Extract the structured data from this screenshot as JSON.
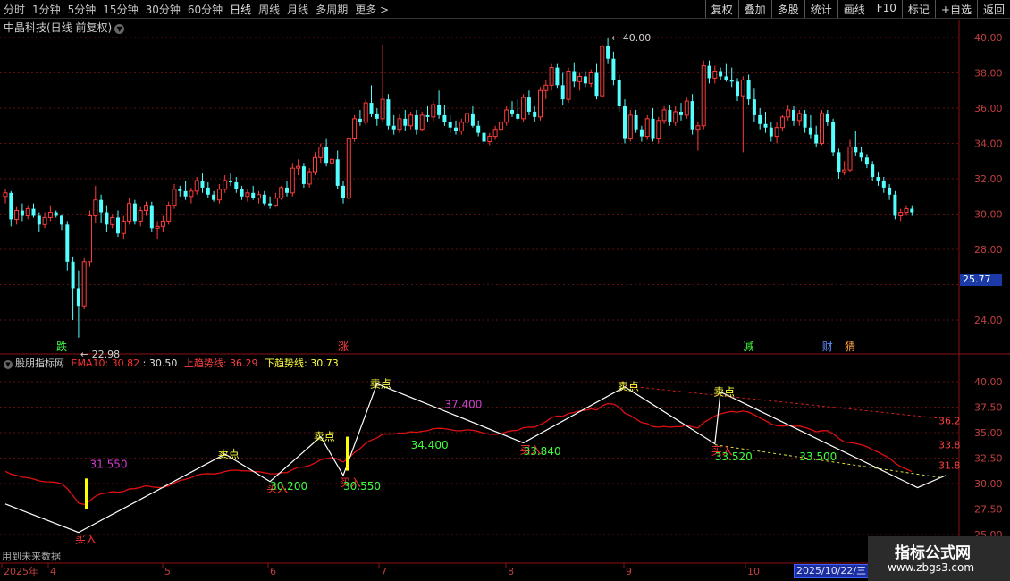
{
  "toolbar": {
    "periods": [
      "分时",
      "1分钟",
      "5分钟",
      "15分钟",
      "30分钟",
      "60分钟",
      "日线",
      "周线",
      "月线",
      "多周期",
      "更多 >"
    ],
    "actions": [
      "复权",
      "叠加",
      "多股",
      "统计",
      "画线",
      "F10",
      "标记",
      "+自选",
      "返回"
    ]
  },
  "stock_title": "中晶科技(日线 前复权)",
  "price_axis": [
    "40.00",
    "38.00",
    "36.00",
    "34.00",
    "32.00",
    "30.00",
    "28.00",
    "24.00"
  ],
  "current_price": "25.77",
  "annotations": {
    "high": "40.00",
    "low": "22.98"
  },
  "markers": [
    "跌",
    "涨",
    "减",
    "财",
    "猜"
  ],
  "indicator": {
    "name": "股朋指标网",
    "ema_label": "EMA10: 30.82",
    "ema_value": ": 30.50",
    "up_trend": "上趋势线: 36.29",
    "down_trend": "下趋势线: 30.73"
  },
  "indicator_axis": [
    "40.00",
    "37.50",
    "35.00",
    "32.50",
    "30.00",
    "27.50",
    "25.00"
  ],
  "indicator_labels": {
    "buy": "买入",
    "sell": "卖点",
    "values": [
      "31.550",
      "30.200",
      "30.550",
      "34.400",
      "37.400",
      "33.840",
      "33.520",
      "33.500"
    ],
    "right_values": [
      "36.2",
      "33.8",
      "31.8"
    ]
  },
  "time_axis": [
    "2025年",
    "4",
    "5",
    "6",
    "7",
    "8",
    "9",
    "10"
  ],
  "date_box": "2025/10/22/三",
  "future_note": "用到未来数据",
  "watermark": {
    "name": "指标公式网",
    "url": "www.zbgs3.com"
  },
  "colors": {
    "up": "#ff3c3c",
    "down": "#54ffff",
    "ema": "#e01010",
    "grid": "#5a1010"
  },
  "chart_data": {
    "type": "candlestick",
    "ylim": [
      22.5,
      41
    ],
    "candles": [
      [
        31.0,
        31.4,
        30.6,
        31.2
      ],
      [
        31.2,
        31.3,
        29.3,
        29.7
      ],
      [
        29.7,
        30.4,
        29.4,
        30.2
      ],
      [
        30.2,
        30.6,
        29.6,
        29.9
      ],
      [
        29.9,
        30.5,
        29.7,
        30.3
      ],
      [
        30.3,
        30.6,
        29.8,
        29.9
      ],
      [
        29.9,
        30.1,
        29.0,
        29.4
      ],
      [
        29.4,
        30.1,
        29.2,
        29.8
      ],
      [
        29.8,
        30.5,
        29.6,
        30.1
      ],
      [
        30.1,
        30.2,
        29.8,
        29.9
      ],
      [
        29.9,
        30.0,
        29.1,
        29.4
      ],
      [
        29.4,
        29.6,
        26.8,
        27.3
      ],
      [
        27.3,
        27.6,
        24.0,
        25.8
      ],
      [
        25.8,
        26.8,
        23.0,
        24.8
      ],
      [
        24.8,
        27.5,
        24.6,
        27.3
      ],
      [
        27.3,
        30.2,
        27.0,
        29.9
      ],
      [
        29.9,
        31.6,
        29.5,
        30.8
      ],
      [
        30.8,
        31.1,
        29.5,
        30.1
      ],
      [
        30.1,
        30.5,
        29.0,
        29.4
      ],
      [
        29.4,
        30.0,
        29.2,
        29.8
      ],
      [
        29.8,
        30.2,
        28.7,
        28.9
      ],
      [
        28.9,
        29.9,
        28.6,
        29.6
      ],
      [
        29.6,
        30.9,
        29.4,
        30.6
      ],
      [
        30.6,
        30.8,
        29.4,
        29.6
      ],
      [
        29.6,
        30.4,
        29.3,
        30.2
      ],
      [
        30.2,
        30.7,
        29.9,
        30.5
      ],
      [
        30.5,
        30.7,
        29.0,
        29.2
      ],
      [
        29.2,
        29.6,
        28.6,
        29.3
      ],
      [
        29.3,
        29.9,
        29.0,
        29.6
      ],
      [
        29.6,
        30.7,
        29.4,
        30.5
      ],
      [
        30.5,
        31.7,
        30.3,
        31.4
      ],
      [
        31.4,
        31.6,
        31.0,
        31.3
      ],
      [
        31.3,
        31.9,
        30.8,
        31.0
      ],
      [
        31.0,
        31.5,
        30.6,
        31.3
      ],
      [
        31.3,
        32.1,
        31.1,
        31.9
      ],
      [
        31.9,
        32.3,
        31.2,
        31.5
      ],
      [
        31.5,
        31.8,
        30.9,
        31.1
      ],
      [
        31.1,
        31.3,
        30.7,
        30.8
      ],
      [
        30.8,
        31.7,
        30.6,
        31.4
      ],
      [
        31.4,
        32.2,
        31.2,
        31.9
      ],
      [
        31.9,
        32.3,
        31.6,
        31.8
      ],
      [
        31.8,
        32.1,
        31.2,
        31.4
      ],
      [
        31.4,
        31.6,
        30.8,
        31.0
      ],
      [
        31.0,
        31.4,
        30.7,
        31.2
      ],
      [
        31.2,
        31.6,
        30.8,
        30.9
      ],
      [
        30.9,
        31.3,
        30.6,
        31.1
      ],
      [
        31.1,
        31.3,
        30.5,
        30.6
      ],
      [
        30.6,
        31.0,
        30.3,
        30.5
      ],
      [
        30.5,
        31.2,
        30.4,
        30.9
      ],
      [
        30.9,
        31.6,
        30.8,
        31.5
      ],
      [
        31.5,
        31.9,
        31.0,
        31.2
      ],
      [
        31.2,
        32.9,
        31.0,
        32.6
      ],
      [
        32.6,
        33.1,
        32.2,
        32.7
      ],
      [
        32.7,
        32.9,
        31.5,
        31.7
      ],
      [
        31.7,
        32.6,
        31.5,
        32.4
      ],
      [
        32.4,
        33.5,
        32.2,
        33.2
      ],
      [
        33.2,
        34.0,
        32.9,
        33.8
      ],
      [
        33.8,
        34.3,
        32.7,
        32.9
      ],
      [
        32.9,
        33.4,
        32.2,
        33.1
      ],
      [
        33.1,
        33.6,
        31.4,
        31.6
      ],
      [
        31.6,
        31.9,
        30.6,
        30.9
      ],
      [
        30.9,
        34.4,
        30.8,
        34.3
      ],
      [
        34.3,
        35.6,
        34.1,
        35.4
      ],
      [
        35.4,
        35.9,
        35.0,
        35.2
      ],
      [
        35.2,
        36.5,
        35.0,
        36.3
      ],
      [
        36.3,
        37.3,
        35.5,
        35.7
      ],
      [
        35.7,
        36.0,
        35.0,
        35.4
      ],
      [
        35.4,
        39.6,
        35.2,
        36.5
      ],
      [
        36.5,
        36.8,
        34.8,
        35.0
      ],
      [
        35.0,
        35.6,
        34.5,
        34.8
      ],
      [
        34.8,
        35.7,
        34.6,
        35.4
      ],
      [
        35.4,
        35.9,
        34.7,
        35.0
      ],
      [
        35.0,
        35.8,
        34.8,
        35.6
      ],
      [
        35.6,
        35.9,
        34.5,
        34.8
      ],
      [
        34.8,
        35.8,
        34.7,
        35.6
      ],
      [
        35.6,
        36.1,
        35.2,
        35.5
      ],
      [
        35.5,
        36.4,
        35.2,
        36.2
      ],
      [
        36.2,
        37.0,
        35.4,
        35.6
      ],
      [
        35.6,
        36.2,
        35.0,
        35.2
      ],
      [
        35.2,
        35.6,
        34.6,
        34.9
      ],
      [
        34.9,
        35.3,
        34.5,
        34.7
      ],
      [
        34.7,
        35.4,
        34.5,
        35.2
      ],
      [
        35.2,
        35.9,
        35.0,
        35.7
      ],
      [
        35.7,
        36.1,
        34.9,
        35.0
      ],
      [
        35.0,
        35.3,
        34.4,
        34.6
      ],
      [
        34.6,
        34.9,
        33.9,
        34.1
      ],
      [
        34.1,
        34.6,
        33.9,
        34.4
      ],
      [
        34.4,
        35.0,
        34.2,
        34.8
      ],
      [
        34.8,
        35.4,
        34.6,
        35.2
      ],
      [
        35.2,
        36.1,
        35.0,
        35.9
      ],
      [
        35.9,
        36.4,
        35.5,
        35.7
      ],
      [
        35.7,
        36.5,
        35.3,
        35.4
      ],
      [
        35.4,
        36.8,
        35.2,
        36.6
      ],
      [
        36.6,
        37.0,
        35.6,
        35.8
      ],
      [
        35.8,
        36.1,
        35.2,
        35.5
      ],
      [
        35.5,
        37.2,
        35.3,
        37.0
      ],
      [
        37.0,
        37.6,
        36.5,
        37.3
      ],
      [
        37.3,
        38.5,
        37.0,
        38.3
      ],
      [
        38.3,
        38.5,
        37.1,
        37.3
      ],
      [
        37.3,
        38.0,
        36.2,
        36.5
      ],
      [
        36.5,
        38.3,
        36.3,
        38.1
      ],
      [
        38.1,
        38.6,
        37.2,
        37.5
      ],
      [
        37.5,
        38.0,
        37.0,
        37.8
      ],
      [
        37.8,
        38.1,
        37.2,
        37.4
      ],
      [
        37.4,
        38.2,
        37.2,
        38.0
      ],
      [
        38.0,
        38.5,
        36.5,
        36.7
      ],
      [
        36.7,
        39.6,
        36.6,
        39.5
      ],
      [
        39.5,
        40.0,
        38.5,
        38.8
      ],
      [
        38.8,
        39.2,
        37.3,
        37.6
      ],
      [
        37.6,
        37.9,
        35.8,
        36.1
      ],
      [
        36.1,
        36.5,
        34.0,
        34.3
      ],
      [
        34.3,
        35.9,
        34.1,
        35.6
      ],
      [
        35.6,
        35.9,
        34.6,
        34.8
      ],
      [
        34.8,
        35.0,
        34.1,
        34.4
      ],
      [
        34.4,
        35.6,
        34.2,
        35.4
      ],
      [
        35.4,
        36.0,
        34.1,
        34.3
      ],
      [
        34.3,
        35.5,
        34.0,
        35.3
      ],
      [
        35.3,
        36.1,
        35.1,
        35.9
      ],
      [
        35.9,
        36.2,
        35.0,
        35.2
      ],
      [
        35.2,
        36.1,
        35.0,
        35.8
      ],
      [
        35.8,
        36.3,
        35.3,
        35.6
      ],
      [
        35.6,
        36.6,
        35.4,
        36.4
      ],
      [
        36.4,
        36.8,
        34.5,
        34.8
      ],
      [
        34.8,
        35.2,
        33.6,
        35.0
      ],
      [
        35.0,
        38.7,
        34.8,
        38.4
      ],
      [
        38.4,
        38.7,
        37.4,
        37.7
      ],
      [
        37.7,
        38.4,
        37.4,
        38.1
      ],
      [
        38.1,
        38.3,
        37.6,
        37.8
      ],
      [
        37.8,
        38.5,
        37.5,
        37.6
      ],
      [
        37.6,
        38.3,
        37.2,
        37.5
      ],
      [
        37.5,
        37.7,
        36.4,
        36.7
      ],
      [
        36.7,
        37.8,
        33.5,
        37.6
      ],
      [
        37.6,
        37.9,
        36.2,
        36.5
      ],
      [
        36.5,
        37.1,
        35.2,
        35.6
      ],
      [
        35.6,
        36.0,
        34.8,
        35.1
      ],
      [
        35.1,
        35.8,
        34.6,
        34.9
      ],
      [
        34.9,
        35.2,
        34.1,
        34.4
      ],
      [
        34.4,
        35.2,
        34.0,
        34.9
      ],
      [
        34.9,
        35.6,
        34.7,
        35.5
      ],
      [
        35.5,
        36.2,
        35.3,
        35.9
      ],
      [
        35.9,
        36.1,
        35.0,
        35.3
      ],
      [
        35.3,
        35.9,
        35.0,
        35.7
      ],
      [
        35.7,
        35.9,
        34.6,
        34.9
      ],
      [
        34.9,
        35.6,
        34.3,
        34.5
      ],
      [
        34.5,
        35.0,
        33.8,
        34.0
      ],
      [
        34.0,
        35.9,
        33.9,
        35.7
      ],
      [
        35.7,
        35.9,
        35.0,
        35.2
      ],
      [
        35.2,
        35.4,
        33.3,
        33.5
      ],
      [
        33.5,
        33.7,
        32.0,
        32.4
      ],
      [
        32.4,
        33.0,
        32.2,
        32.5
      ],
      [
        32.5,
        34.2,
        32.4,
        33.8
      ],
      [
        33.8,
        34.7,
        33.3,
        33.5
      ],
      [
        33.5,
        33.8,
        33.0,
        33.2
      ],
      [
        33.2,
        33.4,
        32.6,
        32.8
      ],
      [
        32.8,
        33.0,
        31.9,
        32.1
      ],
      [
        32.1,
        32.4,
        31.6,
        31.9
      ],
      [
        31.9,
        32.1,
        31.2,
        31.5
      ],
      [
        31.5,
        31.7,
        30.8,
        31.1
      ],
      [
        31.1,
        31.3,
        29.7,
        29.9
      ],
      [
        29.9,
        30.3,
        29.6,
        30.1
      ],
      [
        30.1,
        30.5,
        29.9,
        30.3
      ],
      [
        30.3,
        30.5,
        29.9,
        30.1
      ]
    ]
  }
}
